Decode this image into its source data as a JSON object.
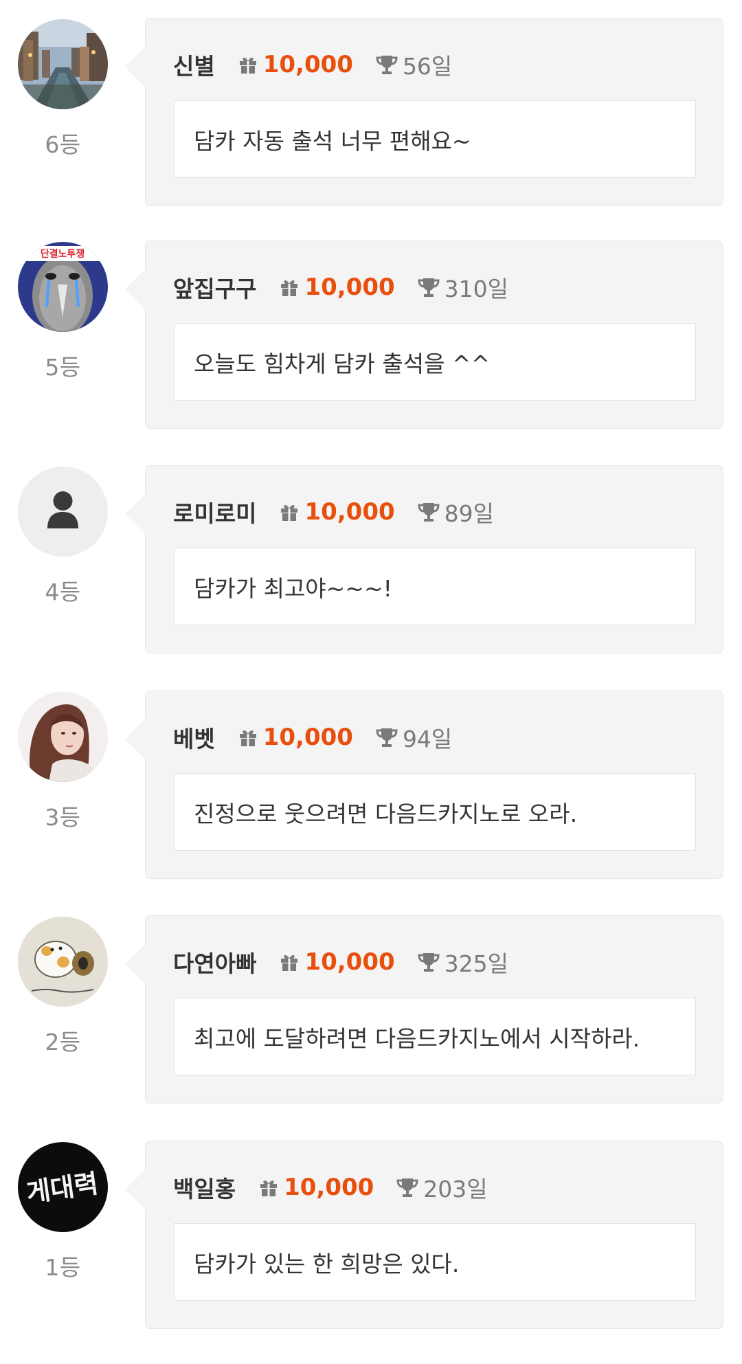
{
  "colors": {
    "points_accent": "#e94f0c",
    "card_background": "#f4f4f4",
    "rank_text": "#8a8a8a"
  },
  "icons": {
    "points": "gift-icon",
    "days": "trophy-icon"
  },
  "entries": [
    {
      "rank": "6등",
      "nickname": "신별",
      "points": "10,000",
      "days": "56일",
      "message": "담카 자동 출석 너무 편해요~",
      "avatar": "city-canal-photo"
    },
    {
      "rank": "5등",
      "nickname": "앞집구구",
      "points": "10,000",
      "days": "310일",
      "message": "오늘도 힘차게 담카 출석을 ^^",
      "avatar": "crying-bird-cartoon",
      "avatar_text": "단결노투쟁"
    },
    {
      "rank": "4등",
      "nickname": "로미로미",
      "points": "10,000",
      "days": "89일",
      "message": "담카가 최고야~~~!",
      "avatar": "default-user-icon"
    },
    {
      "rank": "3등",
      "nickname": "베벳",
      "points": "10,000",
      "days": "94일",
      "message": "진정으로 웃으려면 다음드카지노로 오라.",
      "avatar": "woman-portrait-photo"
    },
    {
      "rank": "2등",
      "nickname": "다연아빠",
      "points": "10,000",
      "days": "325일",
      "message": "최고에 도달하려면 다음드카지노에서 시작하라.",
      "avatar": "hamster-drawing"
    },
    {
      "rank": "1등",
      "nickname": "백일홍",
      "points": "10,000",
      "days": "203일",
      "message": "담카가 있는 한 희망은 있다.",
      "avatar": "neon-sign-photo",
      "avatar_text": "게대력"
    }
  ]
}
